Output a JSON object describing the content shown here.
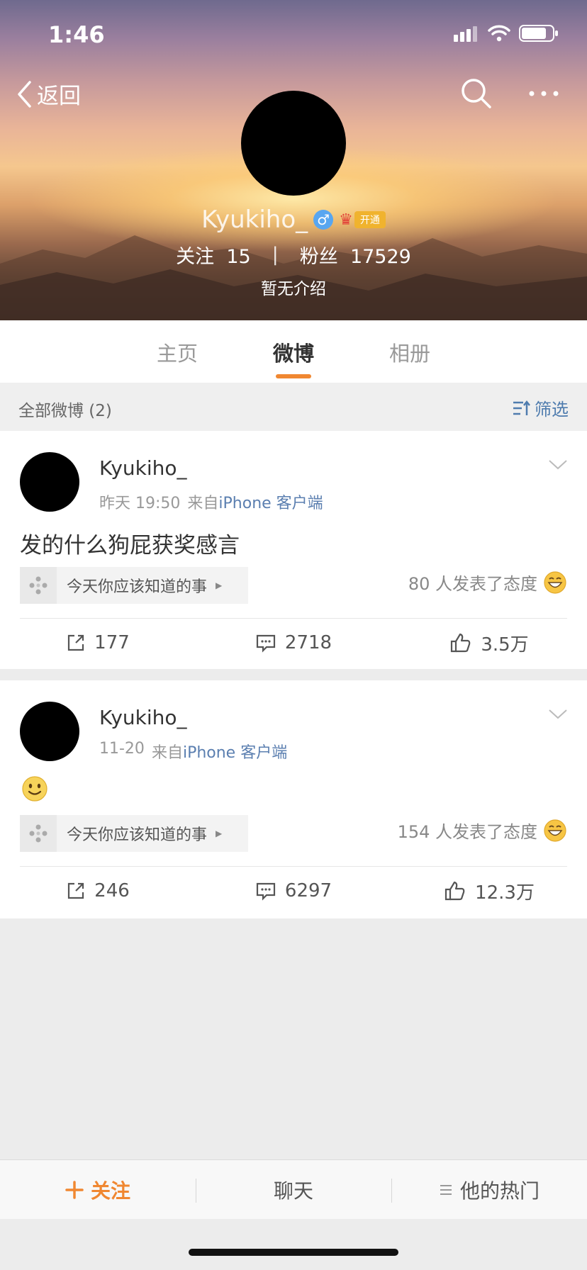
{
  "status": {
    "time": "1:46"
  },
  "nav": {
    "back_label": "返回"
  },
  "profile": {
    "name": "Kyukiho_",
    "gender_symbol": "♂",
    "vip_label": "开通",
    "follow_label": "关注",
    "follow_count": "15",
    "fans_label": "粉丝",
    "fans_count": "17529",
    "bio": "暂无介绍"
  },
  "tabs": [
    {
      "label": "主页"
    },
    {
      "label": "微博",
      "active": true
    },
    {
      "label": "相册"
    }
  ],
  "section": {
    "title": "全部微博 (2)",
    "filter_label": "筛选"
  },
  "posts": [
    {
      "author": "Kyukiho_",
      "time": "昨天 19:50",
      "source_prefix": "来自",
      "source": "iPhone 客户端",
      "text": "发的什么狗屁获奖感言",
      "topic": "今天你应该知道的事",
      "reaction": "80 人发表了态度",
      "reposts": "177",
      "comments": "2718",
      "likes": "3.5万"
    },
    {
      "author": "Kyukiho_",
      "time": "11-20",
      "source_prefix": "来自",
      "source": "iPhone 客户端",
      "text_emoji": "smile-emoji",
      "topic": "今天你应该知道的事",
      "reaction": "154 人发表了态度",
      "reposts": "246",
      "comments": "6297",
      "likes": "12.3万"
    }
  ],
  "bottom_bar": {
    "follow_label": "关注",
    "chat_label": "聊天",
    "hot_label": "他的热门"
  },
  "colors": {
    "accent": "#f08731",
    "link": "#5b7fb0",
    "gender_badge": "#58a6f0"
  }
}
